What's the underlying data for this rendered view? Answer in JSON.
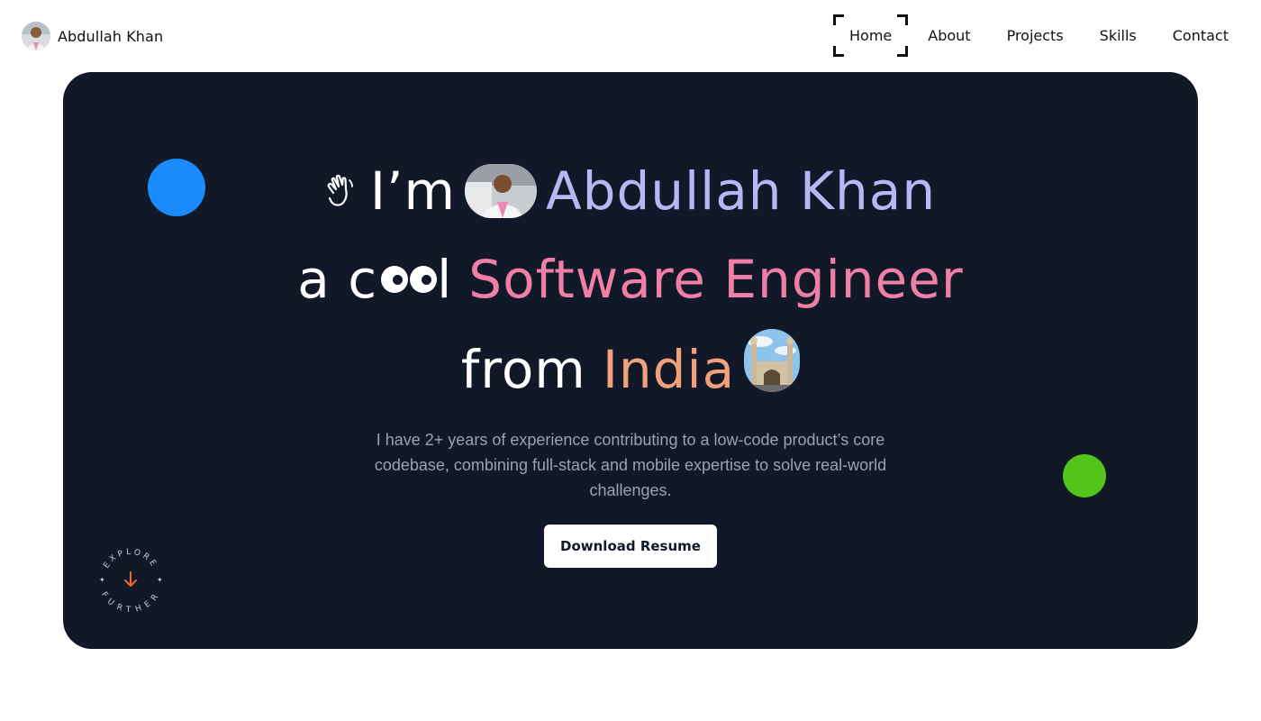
{
  "brand": {
    "name": "Abdullah Khan"
  },
  "nav": {
    "items": [
      {
        "label": "Home",
        "active": true
      },
      {
        "label": "About",
        "active": false
      },
      {
        "label": "Projects",
        "active": false
      },
      {
        "label": "Skills",
        "active": false
      },
      {
        "label": "Contact",
        "active": false
      }
    ]
  },
  "hero": {
    "line1_prefix": "I’m",
    "name": "Abdullah Khan",
    "line2_prefix": "a c",
    "line2_suffix": "l",
    "role": "Software Engineer",
    "line3_prefix": "from",
    "country": "India",
    "description": "I have 2+ years of experience contributing to a low-code product’s core codebase, combining full-stack and mobile expertise to solve real-world challenges.",
    "cta_label": "Download Resume",
    "explore_top": "EXPLORE",
    "explore_bottom": "FURTHER"
  },
  "colors": {
    "hero_bg": "#111827",
    "name": "#b4b9f5",
    "role": "#f07fa8",
    "country": "#f0a07a",
    "blue_dot": "#1a8cff",
    "green_dot": "#52c41a",
    "arrow": "#f06a2a"
  },
  "icons": [
    "waving-hand-icon",
    "arrow-down-icon"
  ]
}
